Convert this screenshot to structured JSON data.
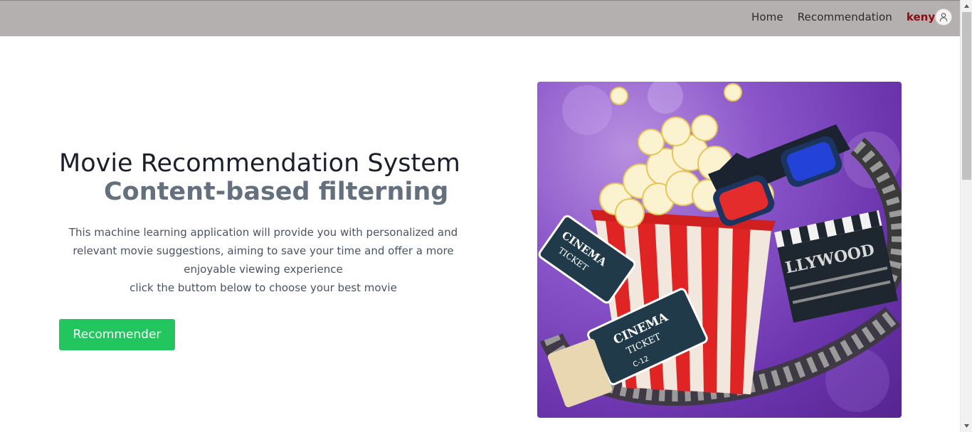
{
  "nav": {
    "home": "Home",
    "recommendation": "Recommendation",
    "user": "kenyat"
  },
  "hero": {
    "title": "Movie Recommendation System",
    "subtitle": "Content-based filterning",
    "description_line1": "This machine learning application will provide you with personalized and relevant movie suggestions, aiming to save your time and offer a more enjoyable viewing experience",
    "description_line2": "click the buttom below to choose your best movie",
    "button_label": "Recommender"
  },
  "image": {
    "ticket1_line1": "CINEMA",
    "ticket1_line2": "TICKET",
    "ticket2_line1": "CINEMA",
    "ticket2_line2": "TICKET",
    "ticket2_code": "C-12",
    "clapper_text": "LLYWOOD"
  },
  "icons": {
    "user": "user-icon",
    "scroll_up": "scroll-up-icon",
    "scroll_down": "scroll-down-icon"
  },
  "colors": {
    "navbar": "#b5b0b0",
    "button": "#22c55e",
    "user_name": "#8b0c0c"
  }
}
